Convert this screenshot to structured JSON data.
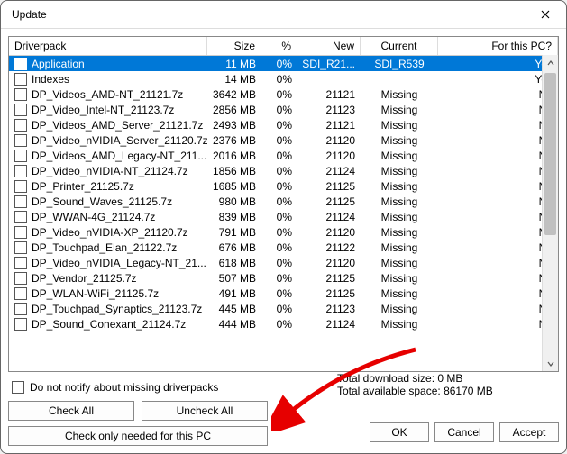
{
  "window": {
    "title": "Update"
  },
  "columns": {
    "name": "Driverpack",
    "size": "Size",
    "pct": "%",
    "new": "New",
    "current": "Current",
    "pc": "For this PC?"
  },
  "rows": [
    {
      "name": "Application",
      "size": "11 MB",
      "pct": "0%",
      "new": "SDI_R21...",
      "current": "SDI_R539",
      "pc": "Yes",
      "selected": true
    },
    {
      "name": "Indexes",
      "size": "14 MB",
      "pct": "0%",
      "new": "",
      "current": "",
      "pc": "Yes"
    },
    {
      "name": "DP_Videos_AMD-NT_21121.7z",
      "size": "3642 MB",
      "pct": "0%",
      "new": "21121",
      "current": "Missing",
      "pc": "No"
    },
    {
      "name": "DP_Video_Intel-NT_21123.7z",
      "size": "2856 MB",
      "pct": "0%",
      "new": "21123",
      "current": "Missing",
      "pc": "No"
    },
    {
      "name": "DP_Videos_AMD_Server_21121.7z",
      "size": "2493 MB",
      "pct": "0%",
      "new": "21121",
      "current": "Missing",
      "pc": "No"
    },
    {
      "name": "DP_Video_nVIDIA_Server_21120.7z",
      "size": "2376 MB",
      "pct": "0%",
      "new": "21120",
      "current": "Missing",
      "pc": "No"
    },
    {
      "name": "DP_Videos_AMD_Legacy-NT_211...",
      "size": "2016 MB",
      "pct": "0%",
      "new": "21120",
      "current": "Missing",
      "pc": "No"
    },
    {
      "name": "DP_Video_nVIDIA-NT_21124.7z",
      "size": "1856 MB",
      "pct": "0%",
      "new": "21124",
      "current": "Missing",
      "pc": "No"
    },
    {
      "name": "DP_Printer_21125.7z",
      "size": "1685 MB",
      "pct": "0%",
      "new": "21125",
      "current": "Missing",
      "pc": "No"
    },
    {
      "name": "DP_Sound_Waves_21125.7z",
      "size": "980 MB",
      "pct": "0%",
      "new": "21125",
      "current": "Missing",
      "pc": "No"
    },
    {
      "name": "DP_WWAN-4G_21124.7z",
      "size": "839 MB",
      "pct": "0%",
      "new": "21124",
      "current": "Missing",
      "pc": "No"
    },
    {
      "name": "DP_Video_nVIDIA-XP_21120.7z",
      "size": "791 MB",
      "pct": "0%",
      "new": "21120",
      "current": "Missing",
      "pc": "No"
    },
    {
      "name": "DP_Touchpad_Elan_21122.7z",
      "size": "676 MB",
      "pct": "0%",
      "new": "21122",
      "current": "Missing",
      "pc": "No"
    },
    {
      "name": "DP_Video_nVIDIA_Legacy-NT_21...",
      "size": "618 MB",
      "pct": "0%",
      "new": "21120",
      "current": "Missing",
      "pc": "No"
    },
    {
      "name": "DP_Vendor_21125.7z",
      "size": "507 MB",
      "pct": "0%",
      "new": "21125",
      "current": "Missing",
      "pc": "No"
    },
    {
      "name": "DP_WLAN-WiFi_21125.7z",
      "size": "491 MB",
      "pct": "0%",
      "new": "21125",
      "current": "Missing",
      "pc": "No"
    },
    {
      "name": "DP_Touchpad_Synaptics_21123.7z",
      "size": "445 MB",
      "pct": "0%",
      "new": "21123",
      "current": "Missing",
      "pc": "No"
    },
    {
      "name": "DP_Sound_Conexant_21124.7z",
      "size": "444 MB",
      "pct": "0%",
      "new": "21124",
      "current": "Missing",
      "pc": "No"
    }
  ],
  "notify": {
    "label": "Do not notify about missing driverpacks"
  },
  "buttons": {
    "check_all": "Check All",
    "uncheck_all": "Uncheck All",
    "check_needed": "Check only needed for this PC",
    "ok": "OK",
    "cancel": "Cancel",
    "accept": "Accept"
  },
  "stats": {
    "download": "Total download size: 0 MB",
    "space": "Total available space: 86170 MB"
  }
}
